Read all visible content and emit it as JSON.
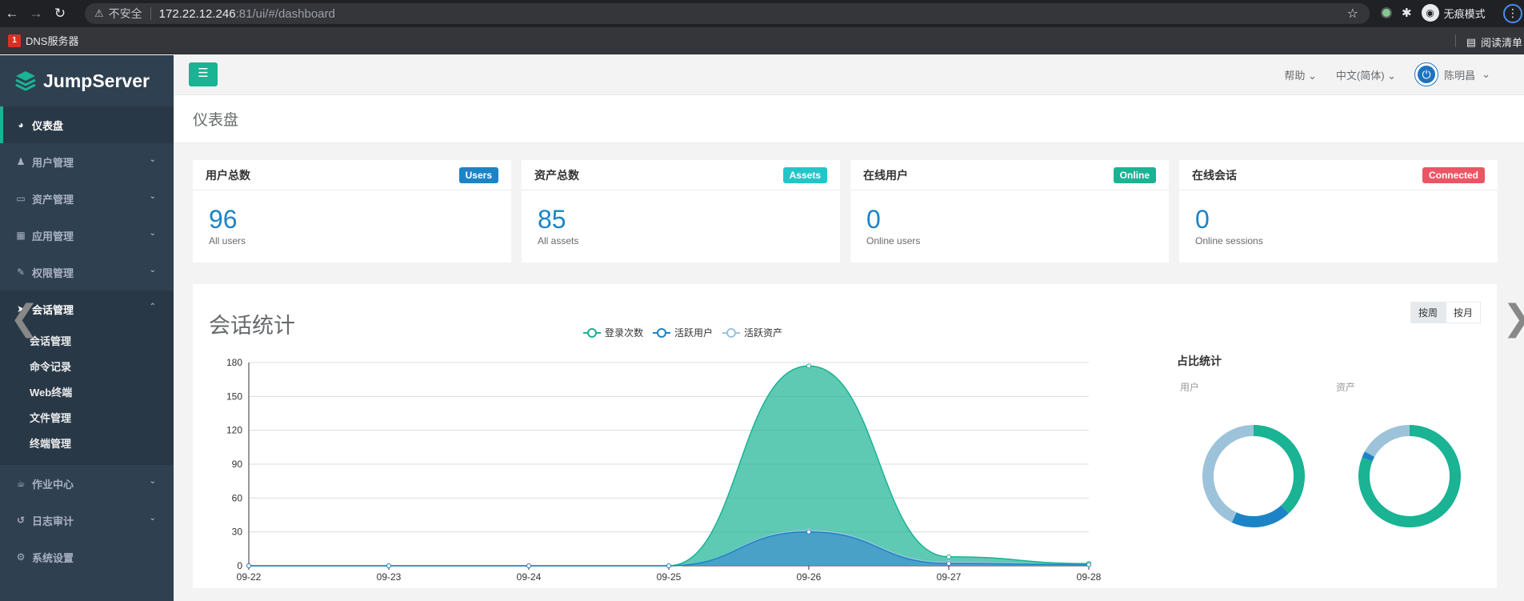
{
  "browser": {
    "url_warning": "不安全",
    "url_host": "172.22.12.246",
    "url_rest": ":81/ui/#/dashboard",
    "profile": "无痕模式",
    "bookmark": "DNS服务器",
    "reading_list": "阅读清单"
  },
  "sidebar": {
    "brand": "JumpServer",
    "items": [
      {
        "label": "仪表盘",
        "icon": "dashboard-icon"
      },
      {
        "label": "用户管理",
        "icon": "users-icon"
      },
      {
        "label": "资产管理",
        "icon": "inbox-icon"
      },
      {
        "label": "应用管理",
        "icon": "grid-icon"
      },
      {
        "label": "权限管理",
        "icon": "edit-icon"
      },
      {
        "label": "会话管理",
        "icon": "rocket-icon"
      },
      {
        "label": "作业中心",
        "icon": "coffee-icon"
      },
      {
        "label": "日志审计",
        "icon": "history-icon"
      },
      {
        "label": "系统设置",
        "icon": "gears-icon"
      }
    ],
    "session_submenu": [
      "会话管理",
      "命令记录",
      "Web终端",
      "文件管理",
      "终端管理"
    ]
  },
  "topbar": {
    "help": "帮助",
    "language": "中文(简体)",
    "username": "陈明昌"
  },
  "page": {
    "title": "仪表盘"
  },
  "stats": [
    {
      "title": "用户总数",
      "badge": "Users",
      "badge_color": "#1c84c6",
      "value": "96",
      "sub": "All users"
    },
    {
      "title": "资产总数",
      "badge": "Assets",
      "badge_color": "#23c6c8",
      "value": "85",
      "sub": "All assets"
    },
    {
      "title": "在线用户",
      "badge": "Online",
      "badge_color": "#1ab394",
      "value": "0",
      "sub": "Online users"
    },
    {
      "title": "在线会话",
      "badge": "Connected",
      "badge_color": "#ed5565",
      "value": "0",
      "sub": "Online sessions"
    }
  ],
  "session_panel": {
    "title": "会话统计",
    "btn_week": "按周",
    "btn_month": "按月",
    "ratio_title": "占比统计",
    "donut_user_label": "用户",
    "donut_asset_label": "资产"
  },
  "chart_data": [
    {
      "type": "area",
      "x": [
        "09-22",
        "09-23",
        "09-24",
        "09-25",
        "09-26",
        "09-27",
        "09-28"
      ],
      "ylim": [
        0,
        180
      ],
      "yticks": [
        0,
        30,
        60,
        90,
        120,
        150,
        180
      ],
      "series": [
        {
          "name": "登录次数",
          "values": [
            0,
            0,
            0,
            0,
            177,
            8,
            2
          ],
          "color": "#1ab394"
        },
        {
          "name": "活跃用户",
          "values": [
            0,
            0,
            0,
            0,
            30,
            2,
            1
          ],
          "color": "#1c84c6"
        },
        {
          "name": "活跃资产",
          "values": [
            0,
            0,
            0,
            0,
            31,
            3,
            1
          ],
          "color": "#9cc3da"
        }
      ]
    },
    {
      "type": "pie",
      "name": "用户",
      "slices": [
        {
          "value": 38,
          "color": "#1ab394"
        },
        {
          "value": 19,
          "color": "#1c84c6"
        },
        {
          "value": 43,
          "color": "#9cc3da"
        }
      ]
    },
    {
      "type": "pie",
      "name": "资产",
      "slices": [
        {
          "value": 81,
          "color": "#1ab394"
        },
        {
          "value": 2,
          "color": "#1c84c6"
        },
        {
          "value": 17,
          "color": "#9cc3da"
        }
      ]
    }
  ]
}
